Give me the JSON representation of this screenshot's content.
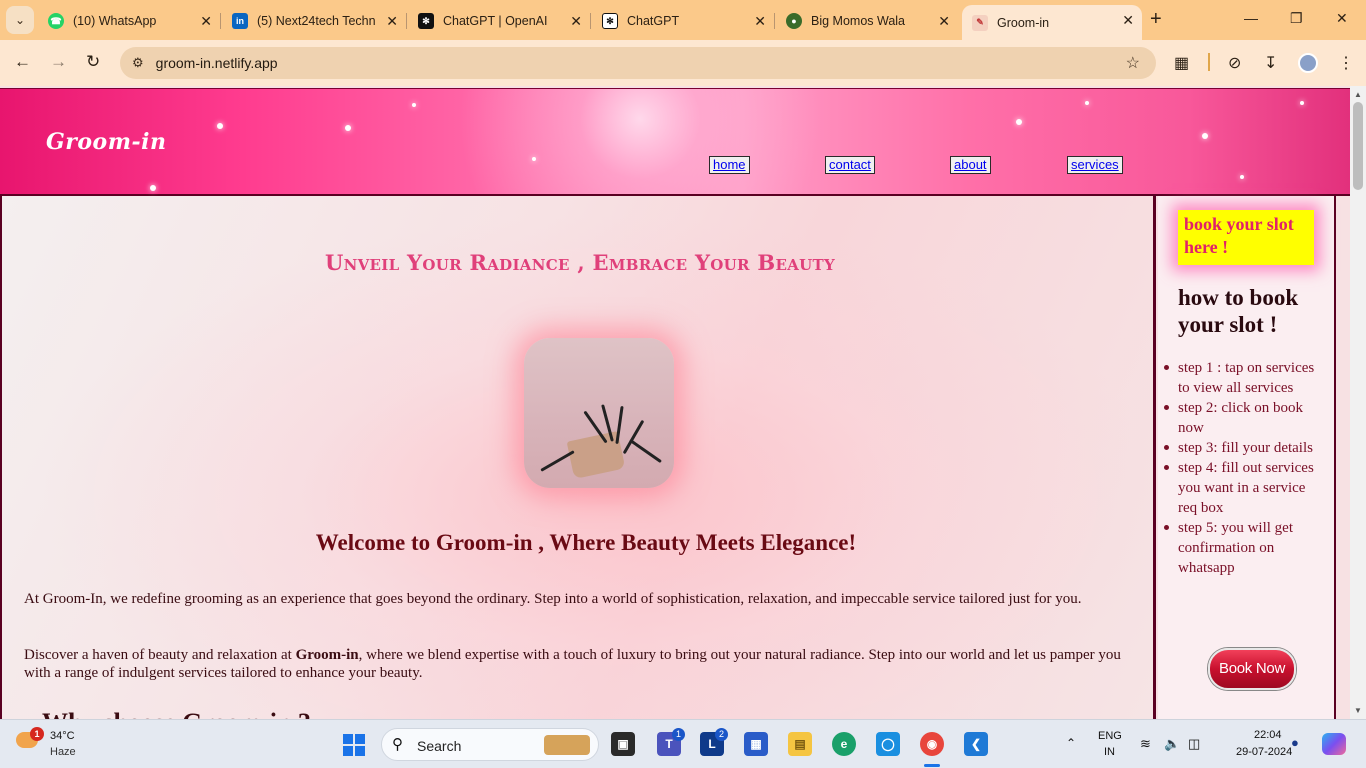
{
  "browser": {
    "tabs": [
      {
        "title": "(10) WhatsApp",
        "icon": "whatsapp-icon",
        "color": "#25d366"
      },
      {
        "title": "(5) Next24tech Techn",
        "icon": "linkedin-icon",
        "color": "#0a66c2"
      },
      {
        "title": "ChatGPT | OpenAI",
        "icon": "openai-icon",
        "color": "#111111"
      },
      {
        "title": "ChatGPT",
        "icon": "openai-icon",
        "color": "#111111"
      },
      {
        "title": "Big Momos Wala",
        "icon": "momos-icon",
        "color": "#3a6b2a"
      },
      {
        "title": "Groom-in",
        "icon": "groomin-icon",
        "color": "#d64a4a",
        "active": true
      }
    ],
    "url": "groom-in.netlify.app"
  },
  "site": {
    "logo": "Groom-in",
    "nav": {
      "home": "home",
      "contact": "contact",
      "about": "about",
      "services": "services"
    },
    "tagline": "Unveil Your Radiance , Embrace Your Beauty",
    "welcome": "Welcome to Groom-in , Where Beauty Meets Elegance!",
    "para1": "At Groom-In, we redefine grooming as an experience that goes beyond the ordinary. Step into a world of sophistication, relaxation, and impeccable service tailored just for you.",
    "para2_a": "Discover a haven of beauty and relaxation at ",
    "para2_b": "Groom-in",
    "para2_c": ", where we blend expertise with a touch of luxury to bring out your natural radiance. Step into our world and let us pamper you with a range of indulgent services tailored to enhance your beauty.",
    "next_heading": "Why choose Groom-in ?"
  },
  "sidebar": {
    "book_slot": "book your slot here !",
    "howto": "how to book your slot !",
    "steps": [
      "step 1 : tap on services to view all services",
      "step 2: click on book now",
      "step 3: fill your details",
      "step 4: fill out services you want in a service req box",
      "step 5: you will get confirmation on whatsapp"
    ],
    "book_now": "Book Now"
  },
  "taskbar": {
    "temp": "34°C",
    "condition": "Haze",
    "weather_badge": "1",
    "search": "Search",
    "teams_badge": "1",
    "l_badge": "2",
    "lang1": "ENG",
    "lang2": "IN",
    "time": "22:04",
    "date": "29-07-2024"
  }
}
